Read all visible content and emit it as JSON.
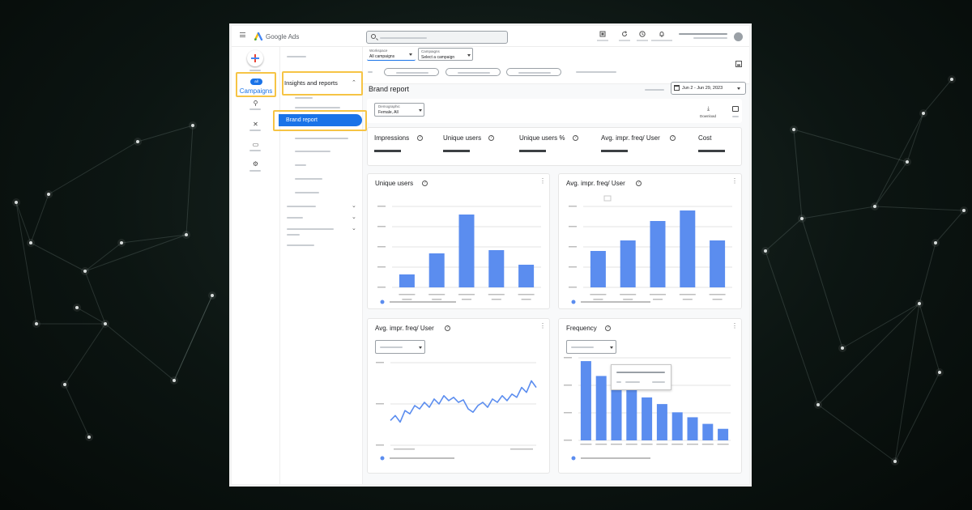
{
  "app": {
    "logo_text": "Google Ads",
    "brand_colors": {
      "blue": "#4285f4",
      "red": "#ea4335",
      "yellow": "#fbbc04",
      "green": "#34a853"
    }
  },
  "topbar": {
    "icons": [
      "menu-icon",
      "search-icon",
      "appearance-icon",
      "refresh-icon",
      "help-icon",
      "notifications-icon"
    ]
  },
  "rail": {
    "create_icon": "plus-icon",
    "campaigns_badge": "all",
    "campaigns_label": "Campaigns",
    "icons": [
      "goals-icon",
      "tools-icon",
      "billing-icon",
      "admin-icon"
    ]
  },
  "nav": {
    "section_title": "Insights and reports",
    "active_item": "Brand report"
  },
  "header": {
    "workspace": {
      "caption": "Workspace",
      "value": "All campaigns"
    },
    "campaigns": {
      "caption": "Campaigns",
      "value": "Select a campaign"
    },
    "page_title": "Brand report",
    "date_range": "Jun 2 - Jun 29, 2023"
  },
  "filters": {
    "demographic_caption": "Demographic",
    "demographic_value": "Female, All",
    "download_label": "Download"
  },
  "metrics": [
    {
      "label": "Impressions"
    },
    {
      "label": "Unique users"
    },
    {
      "label": "Unique users %"
    },
    {
      "label": "Avg. impr. freq/ User"
    },
    {
      "label": "Cost"
    }
  ],
  "accent_color": "#1a73e8",
  "highlight_color": "#f6c445",
  "chart_data": [
    {
      "type": "bar",
      "title": "Unique users",
      "values": [
        16,
        42,
        90,
        46,
        28
      ],
      "ylim": [
        0,
        100
      ],
      "color": "#5b8def"
    },
    {
      "type": "bar",
      "title": "Avg. impr. freq/ User",
      "values": [
        45,
        58,
        82,
        95,
        58
      ],
      "ylim": [
        0,
        100
      ],
      "color": "#5b8def"
    },
    {
      "type": "line",
      "title": "Avg. impr. freq/ User",
      "values": [
        30,
        36,
        28,
        42,
        38,
        48,
        44,
        52,
        46,
        56,
        50,
        60,
        54,
        58,
        52,
        55,
        44,
        40,
        48,
        52,
        46,
        56,
        52,
        60,
        54,
        62,
        58,
        70,
        64,
        78,
        70
      ],
      "ylim": [
        0,
        100
      ],
      "color": "#5b8def"
    },
    {
      "type": "bar",
      "title": "Frequency",
      "values": [
        96,
        78,
        70,
        62,
        52,
        44,
        34,
        28,
        20,
        14
      ],
      "ylim": [
        0,
        100
      ],
      "color": "#5b8def"
    }
  ]
}
